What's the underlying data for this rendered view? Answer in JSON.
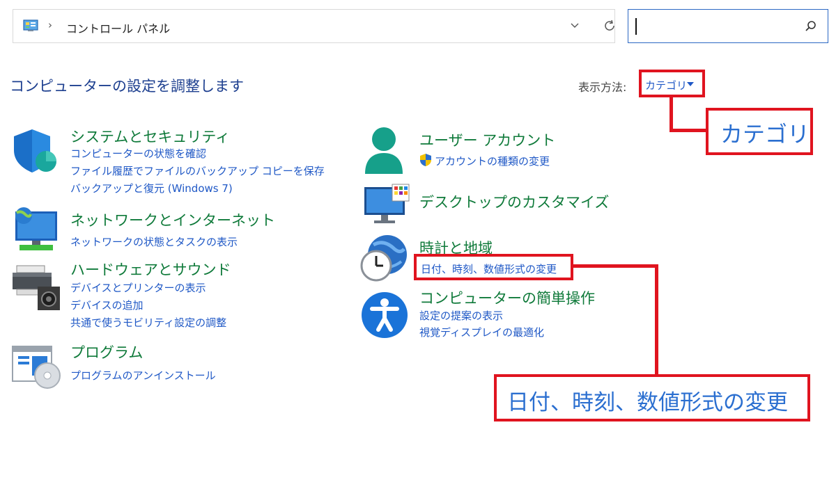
{
  "address_bar": {
    "breadcrumb": "コントロール パネル",
    "separator": "›"
  },
  "search": {
    "placeholder": ""
  },
  "header": {
    "title": "コンピューターの設定を調整します",
    "view_by_label": "表示方法:",
    "view_by_value": "カテゴリ"
  },
  "categories": [
    {
      "title": "システムとセキュリティ",
      "icon": "shield-icon",
      "links": [
        "コンピューターの状態を確認",
        "ファイル履歴でファイルのバックアップ コピーを保存",
        "バックアップと復元 (Windows 7)"
      ]
    },
    {
      "title": "ネットワークとインターネット",
      "icon": "network-globe-icon",
      "links": [
        "ネットワークの状態とタスクの表示"
      ]
    },
    {
      "title": "ハードウェアとサウンド",
      "icon": "printer-speaker-icon",
      "links": [
        "デバイスとプリンターの表示",
        "デバイスの追加",
        "共通で使うモビリティ設定の調整"
      ]
    },
    {
      "title": "プログラム",
      "icon": "programs-disc-icon",
      "links": [
        "プログラムのアンインストール"
      ]
    },
    {
      "title": "ユーザー アカウント",
      "icon": "user-icon",
      "links": [
        "アカウントの種類の変更"
      ]
    },
    {
      "title": "デスクトップのカスタマイズ",
      "icon": "monitor-icon",
      "links": []
    },
    {
      "title": "時計と地域",
      "icon": "clock-globe-icon",
      "links": [
        "日付、時刻、数値形式の変更"
      ]
    },
    {
      "title": "コンピューターの簡単操作",
      "icon": "accessibility-icon",
      "links": [
        "設定の提案の表示",
        "視覚ディスプレイの最適化"
      ]
    }
  ],
  "annotations": {
    "view_by_callout": "カテゴリ",
    "datetime_callout": "日付、時刻、数値形式の変更"
  },
  "colors": {
    "category_title": "#0f7a3a",
    "link": "#1f58c6",
    "title": "#1d3f8f",
    "annotation": "#e0141f"
  }
}
